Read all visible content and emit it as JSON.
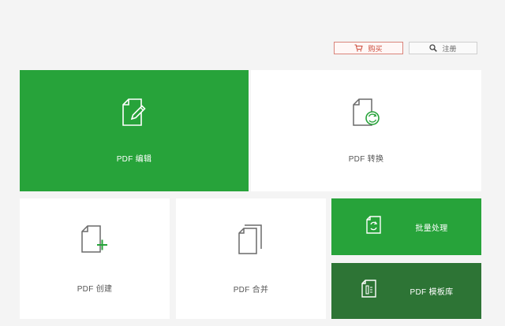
{
  "header": {
    "buy_label": "购买",
    "register_label": "注册",
    "buy_color": "#cc4a3a"
  },
  "tiles": {
    "edit": {
      "label": "PDF 编辑",
      "icon": "document-edit-icon",
      "color": "#27a33a"
    },
    "convert": {
      "label": "PDF 转换",
      "icon": "document-convert-icon",
      "color": "#ffffff"
    },
    "create": {
      "label": "PDF 创建",
      "icon": "document-add-icon",
      "color": "#ffffff"
    },
    "merge": {
      "label": "PDF 合并",
      "icon": "documents-merge-icon",
      "color": "#ffffff"
    },
    "batch": {
      "label": "批量处理",
      "icon": "batch-process-icon",
      "color": "#27a33a"
    },
    "template": {
      "label": "PDF 模板库",
      "icon": "template-library-icon",
      "color": "#2d7435"
    }
  }
}
